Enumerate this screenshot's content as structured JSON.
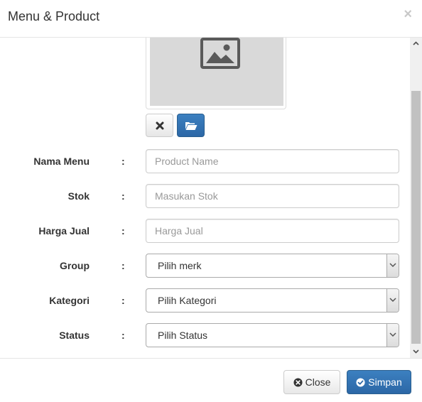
{
  "modal": {
    "title": "Menu & Product",
    "close_glyph": "×"
  },
  "image": {
    "icon": "image-placeholder-icon",
    "remove_icon": "times-icon",
    "browse_icon": "folder-open-icon"
  },
  "form": {
    "colon": ":",
    "fields": [
      {
        "label": "Nama Menu",
        "placeholder": "Product Name",
        "value": ""
      },
      {
        "label": "Stok",
        "placeholder": "Masukan Stok",
        "value": ""
      },
      {
        "label": "Harga Jual",
        "placeholder": "Harga Jual",
        "value": ""
      }
    ],
    "selects": [
      {
        "label": "Group",
        "selected": "Pilih merk"
      },
      {
        "label": "Kategori",
        "selected": "Pilih Kategori"
      },
      {
        "label": "Status",
        "selected": "Pilih Status"
      }
    ]
  },
  "footer": {
    "close_label": "Close",
    "save_label": "Simpan"
  },
  "colors": {
    "primary": "#337ab7",
    "placeholder_bg": "#d9d9d9",
    "border": "#cccccc"
  }
}
